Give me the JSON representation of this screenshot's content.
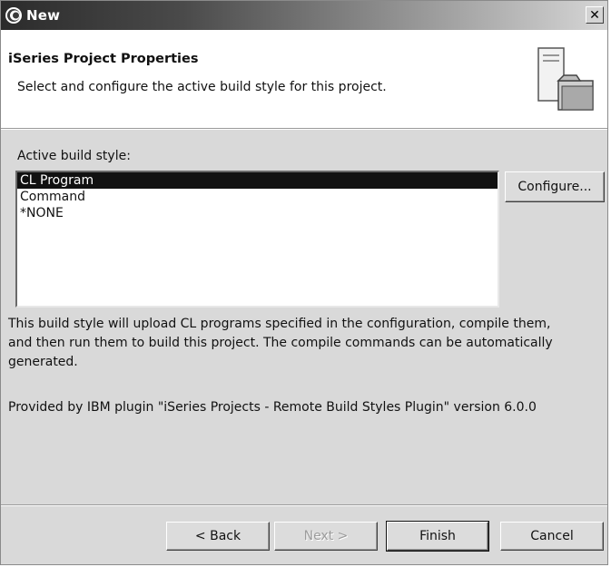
{
  "window": {
    "title": "New",
    "close_glyph": "✕"
  },
  "header": {
    "title": "iSeries Project Properties",
    "description": "Select and configure the active build style for this project.",
    "graphic_icon": "project-wizard-icon"
  },
  "build_style": {
    "label": "Active build style:",
    "items": [
      {
        "label": "CL Program",
        "selected": true
      },
      {
        "label": "Command",
        "selected": false
      },
      {
        "label": "*NONE",
        "selected": false
      }
    ],
    "configure_label": "Configure..."
  },
  "description": {
    "line1": "This build style will upload CL programs specified in the configuration, compile them,",
    "line2": "and then run them to build this project.  The compile commands can be automatically",
    "line3": "generated."
  },
  "provided_by": "Provided by IBM plugin \"iSeries Projects - Remote Build Styles Plugin\" version 6.0.0",
  "buttons": {
    "back": "< Back",
    "next": "Next >",
    "finish": "Finish",
    "cancel": "Cancel"
  }
}
